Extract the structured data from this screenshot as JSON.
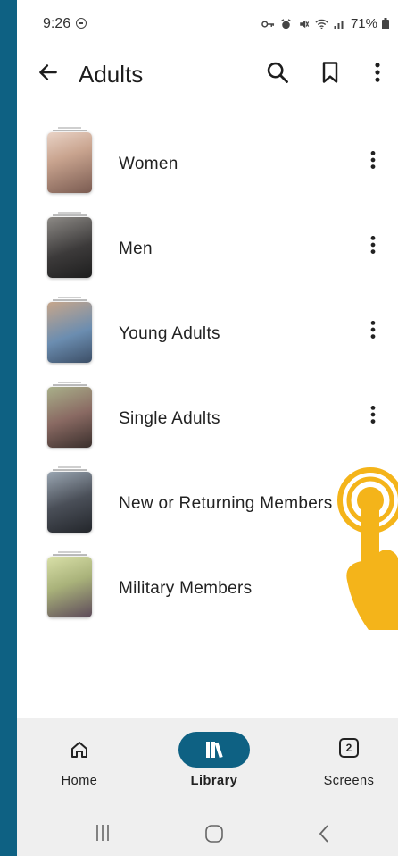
{
  "status_bar": {
    "time": "9:26",
    "battery": "71%"
  },
  "header": {
    "title": "Adults"
  },
  "items": [
    {
      "label": "Women",
      "thumb_color": "#c9a48f"
    },
    {
      "label": "Men",
      "thumb_color": "#3c3a3a"
    },
    {
      "label": "Young Adults",
      "thumb_color": "#6b8db0"
    },
    {
      "label": "Single Adults",
      "thumb_color": "#8a6a63"
    },
    {
      "label": "New or Returning Members",
      "thumb_color": "#4a4f58"
    },
    {
      "label": "Military Members",
      "thumb_color": "#a9b27a"
    }
  ],
  "bottom_nav": {
    "home": "Home",
    "library": "Library",
    "screens": "Screens",
    "screens_count": "2"
  },
  "colors": {
    "accent": "#0e6183",
    "pointer": "#f4b41a"
  }
}
